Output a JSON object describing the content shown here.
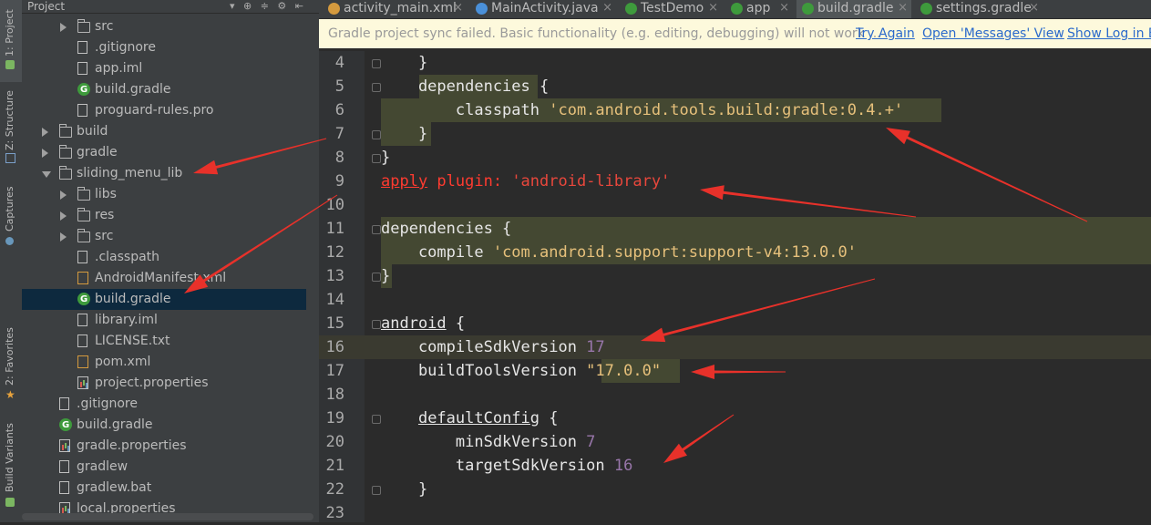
{
  "left_toolwindow": {
    "tabs": [
      {
        "label": "1: Project",
        "icon": "project-icon"
      },
      {
        "label": "Z: Structure",
        "icon": "structure-icon"
      },
      {
        "label": "Captures",
        "icon": "captures-icon"
      },
      {
        "label": "2: Favorites",
        "icon": "star-icon"
      },
      {
        "label": "Build Variants",
        "icon": "android-icon"
      }
    ]
  },
  "project_panel": {
    "title": "Project",
    "tools": "▾ ⊕ ≑ ⚙ ⇤",
    "tree": [
      {
        "label": "src",
        "type": "folder",
        "level": 2,
        "expand": "closed"
      },
      {
        "label": ".gitignore",
        "type": "file",
        "level": 2,
        "expand": "none"
      },
      {
        "label": "app.iml",
        "type": "file",
        "level": 2,
        "expand": "none"
      },
      {
        "label": "build.gradle",
        "type": "gradle",
        "level": 2,
        "expand": "none"
      },
      {
        "label": "proguard-rules.pro",
        "type": "file",
        "level": 2,
        "expand": "none"
      },
      {
        "label": "build",
        "type": "folder",
        "level": 1,
        "expand": "closed"
      },
      {
        "label": "gradle",
        "type": "folder",
        "level": 1,
        "expand": "closed"
      },
      {
        "label": "sliding_menu_lib",
        "type": "folder",
        "level": 1,
        "expand": "open"
      },
      {
        "label": "libs",
        "type": "folder",
        "level": 2,
        "expand": "closed"
      },
      {
        "label": "res",
        "type": "folder",
        "level": 2,
        "expand": "closed"
      },
      {
        "label": "src",
        "type": "folder",
        "level": 2,
        "expand": "closed"
      },
      {
        "label": ".classpath",
        "type": "file",
        "level": 2,
        "expand": "none"
      },
      {
        "label": "AndroidManifest.xml",
        "type": "xml",
        "level": 2,
        "expand": "none"
      },
      {
        "label": "build.gradle",
        "type": "gradle",
        "level": 2,
        "expand": "none",
        "selected": true
      },
      {
        "label": "library.iml",
        "type": "file",
        "level": 2,
        "expand": "none"
      },
      {
        "label": "LICENSE.txt",
        "type": "file",
        "level": 2,
        "expand": "none"
      },
      {
        "label": "pom.xml",
        "type": "xml",
        "level": 2,
        "expand": "none"
      },
      {
        "label": "project.properties",
        "type": "props",
        "level": 2,
        "expand": "none"
      },
      {
        "label": ".gitignore",
        "type": "file",
        "level": 1,
        "expand": "none"
      },
      {
        "label": "build.gradle",
        "type": "gradle",
        "level": 1,
        "expand": "none"
      },
      {
        "label": "gradle.properties",
        "type": "props",
        "level": 1,
        "expand": "none"
      },
      {
        "label": "gradlew",
        "type": "file",
        "level": 1,
        "expand": "none"
      },
      {
        "label": "gradlew.bat",
        "type": "file",
        "level": 1,
        "expand": "none"
      },
      {
        "label": "local.properties",
        "type": "props",
        "level": 1,
        "expand": "none"
      }
    ]
  },
  "editor_tabs": [
    {
      "label": "activity_main.xml",
      "icon": "xml-file-icon",
      "color": "#d49a3e",
      "active": false
    },
    {
      "label": "MainActivity.java",
      "icon": "class-icon",
      "color": "#4a90d9",
      "active": false
    },
    {
      "label": "TestDemo",
      "icon": "gradle-icon",
      "color": "#3e9a3c",
      "active": false
    },
    {
      "label": "app",
      "icon": "gradle-icon",
      "color": "#3e9a3c",
      "active": false
    },
    {
      "label": "build.gradle",
      "icon": "gradle-icon",
      "color": "#3e9a3c",
      "active": true
    },
    {
      "label": "settings.gradle",
      "icon": "gradle-icon",
      "color": "#3e9a3c",
      "active": false
    }
  ],
  "sync_banner": {
    "message": "Gradle project sync failed. Basic functionality (e.g. editing, debugging) will not work ...",
    "actions": [
      "Try Again",
      "Open 'Messages' View",
      "Show Log in E"
    ]
  },
  "code_lines": [
    {
      "num": "4",
      "segments": [
        {
          "t": "    }",
          "c": ""
        }
      ]
    },
    {
      "num": "5",
      "segments": [
        {
          "t": "    dependencies {",
          "c": ""
        }
      ]
    },
    {
      "num": "6",
      "segments": [
        {
          "t": "        classpath ",
          "c": ""
        },
        {
          "t": "'com.android.tools.build:gradle:0.4.+'",
          "c": "str"
        }
      ]
    },
    {
      "num": "7",
      "segments": [
        {
          "t": "    }",
          "c": ""
        }
      ]
    },
    {
      "num": "8",
      "segments": [
        {
          "t": "}",
          "c": ""
        }
      ]
    },
    {
      "num": "9",
      "segments": [
        {
          "t": "apply",
          "c": "red ul"
        },
        {
          "t": " plugin: ",
          "c": "red"
        },
        {
          "t": "'android-library'",
          "c": "strred"
        }
      ]
    },
    {
      "num": "10",
      "segments": []
    },
    {
      "num": "11",
      "segments": [
        {
          "t": "dependencies {",
          "c": ""
        }
      ]
    },
    {
      "num": "12",
      "segments": [
        {
          "t": "    compile ",
          "c": ""
        },
        {
          "t": "'com.android.support:support-v4:13.0.0'",
          "c": "str"
        }
      ]
    },
    {
      "num": "13",
      "segments": [
        {
          "t": "}",
          "c": ""
        }
      ]
    },
    {
      "num": "14",
      "segments": []
    },
    {
      "num": "15",
      "segments": [
        {
          "t": "android",
          "c": "ul"
        },
        {
          "t": " {",
          "c": ""
        }
      ]
    },
    {
      "num": "16",
      "segments": [
        {
          "t": "    compileSdkVersion ",
          "c": ""
        },
        {
          "t": "17",
          "c": "num"
        }
      ]
    },
    {
      "num": "17",
      "segments": [
        {
          "t": "    buildToolsVersion ",
          "c": ""
        },
        {
          "t": "\"17.0.0\"",
          "c": "str"
        }
      ]
    },
    {
      "num": "18",
      "segments": []
    },
    {
      "num": "19",
      "segments": [
        {
          "t": "    ",
          "c": ""
        },
        {
          "t": "defaultConfig",
          "c": "ul"
        },
        {
          "t": " {",
          "c": ""
        }
      ]
    },
    {
      "num": "20",
      "segments": [
        {
          "t": "        minSdkVersion ",
          "c": ""
        },
        {
          "t": "7",
          "c": "num"
        }
      ]
    },
    {
      "num": "21",
      "segments": [
        {
          "t": "        targetSdkVersion ",
          "c": ""
        },
        {
          "t": "16",
          "c": "num"
        }
      ]
    },
    {
      "num": "22",
      "segments": [
        {
          "t": "    }",
          "c": ""
        }
      ]
    },
    {
      "num": "23",
      "segments": []
    }
  ],
  "colors": {
    "panel_bg": "#3c3f41",
    "editor_bg": "#2b2b2b",
    "annotation_arrow": "#e8312a",
    "string": "#e6c07b",
    "number": "#9876aa",
    "error": "#ff3b30",
    "selection": "#0d293e"
  }
}
